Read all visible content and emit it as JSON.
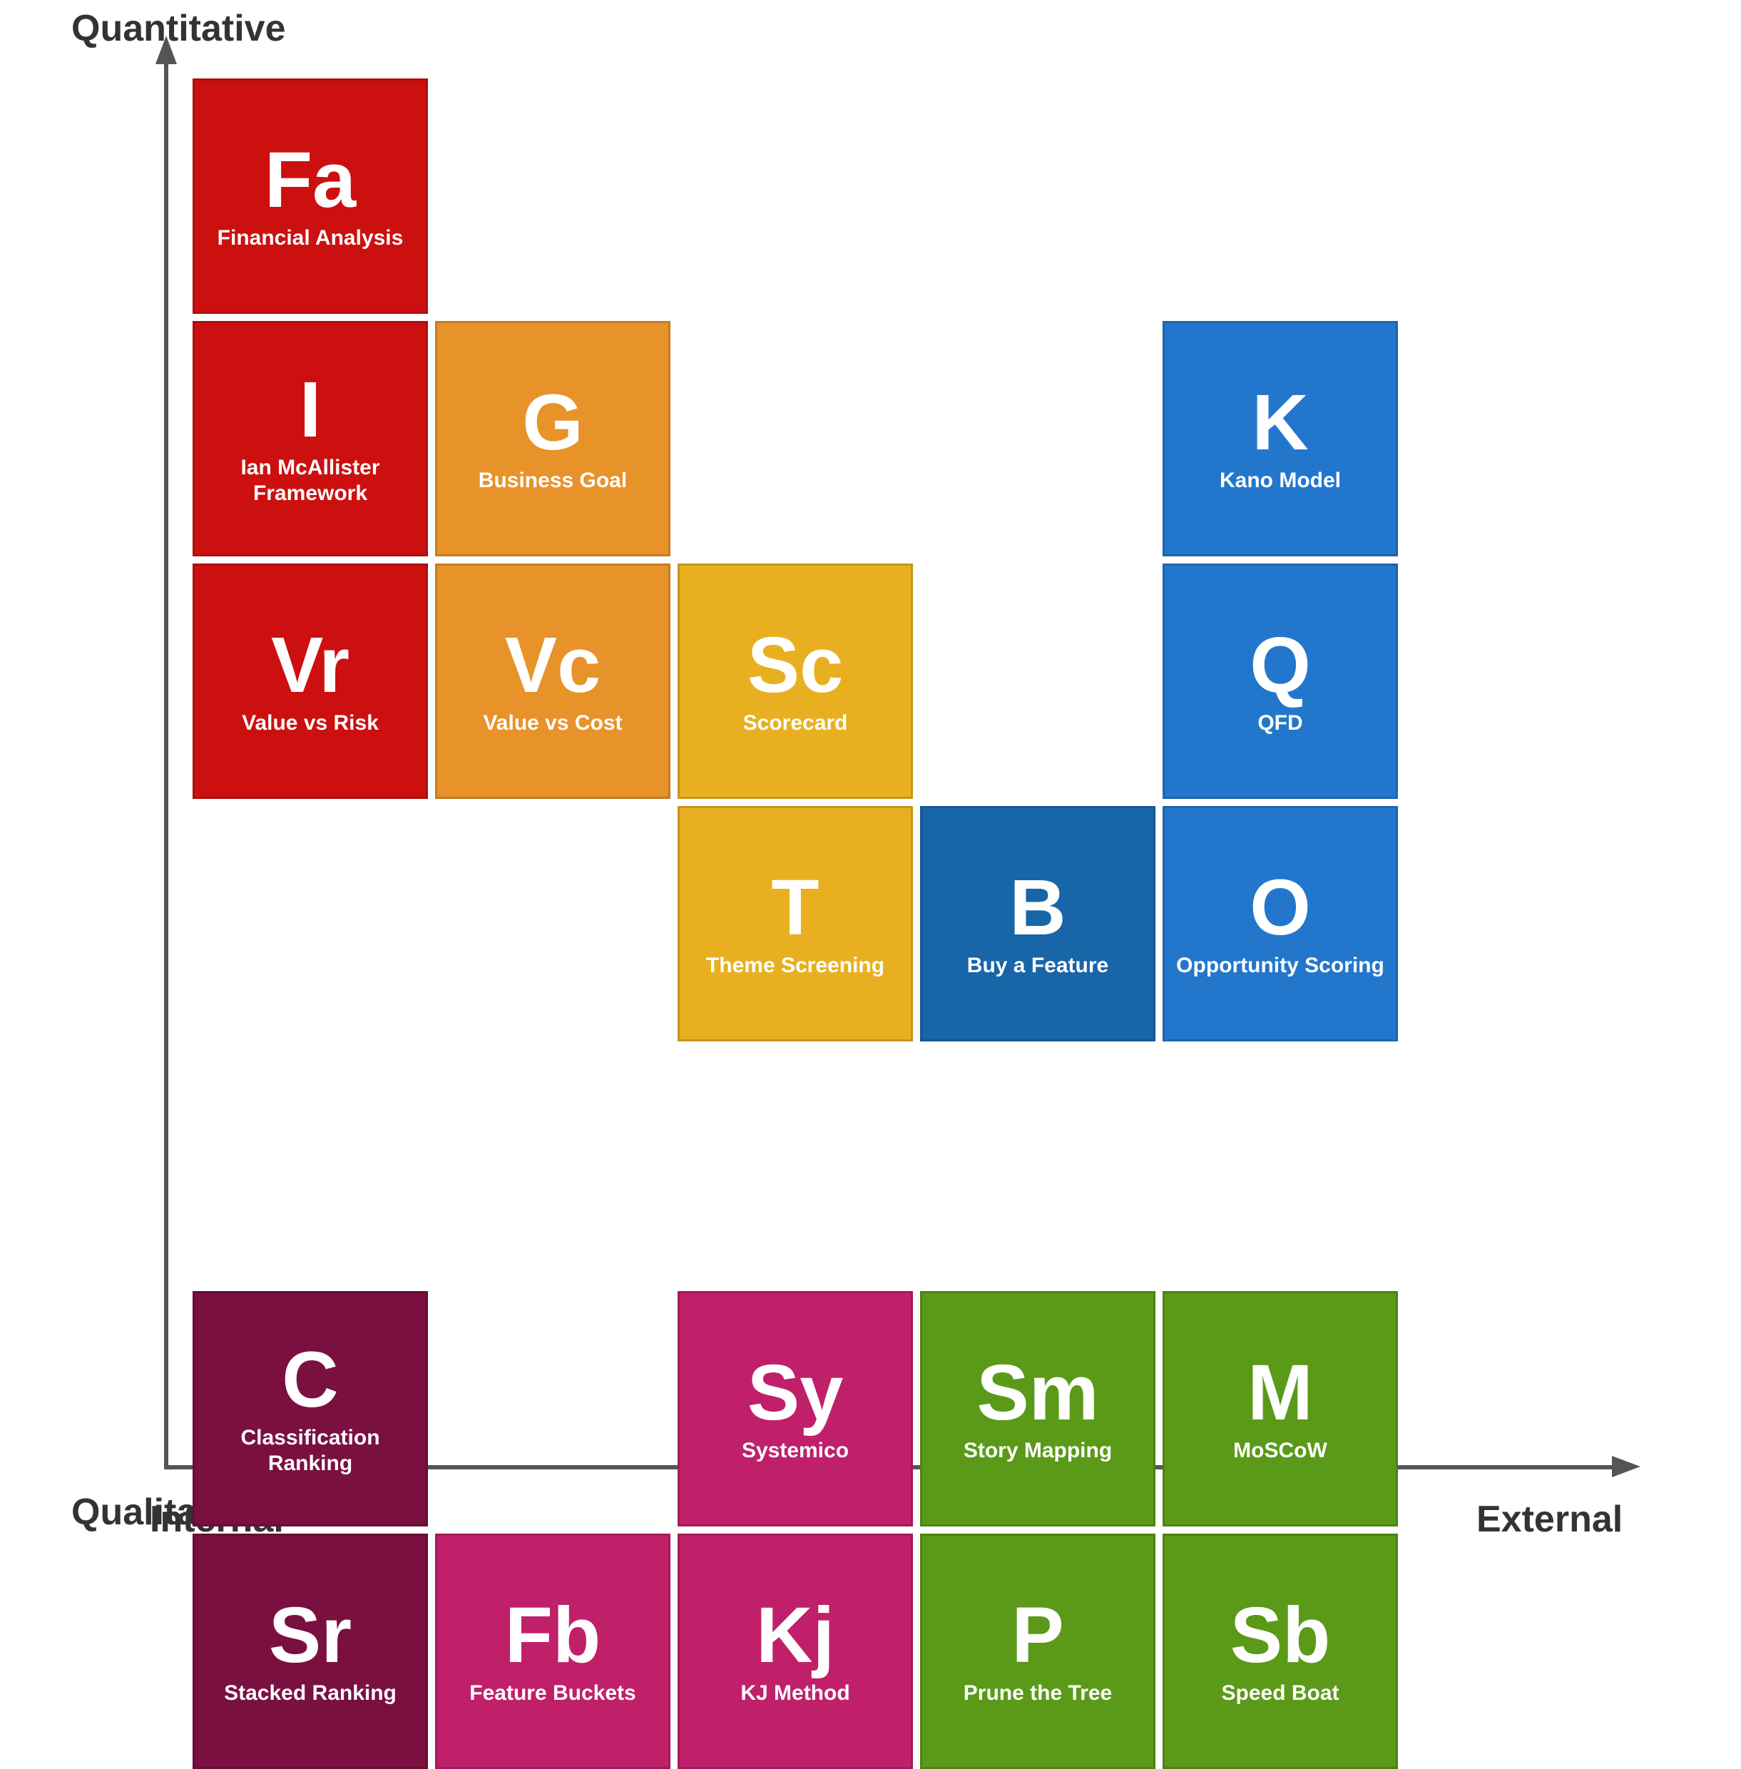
{
  "axes": {
    "y_top": "Quantitative",
    "y_bottom": "Qualitative",
    "x_left": "Internal",
    "x_right": "External"
  },
  "cards": [
    {
      "id": "fa",
      "abbr": "Fa",
      "name": "Financial Analysis",
      "color": "red",
      "col": 0,
      "row": 0
    },
    {
      "id": "i",
      "abbr": "I",
      "name": "Ian McAllister Framework",
      "color": "red",
      "col": 0,
      "row": 1
    },
    {
      "id": "g",
      "abbr": "G",
      "name": "Business Goal",
      "color": "orange",
      "col": 1,
      "row": 1
    },
    {
      "id": "vr",
      "abbr": "Vr",
      "name": "Value vs Risk",
      "color": "red",
      "col": 0,
      "row": 2
    },
    {
      "id": "vc",
      "abbr": "Vc",
      "name": "Value vs Cost",
      "color": "orange",
      "col": 1,
      "row": 2
    },
    {
      "id": "sc",
      "abbr": "Sc",
      "name": "Scorecard",
      "color": "gold",
      "col": 2,
      "row": 2
    },
    {
      "id": "t",
      "abbr": "T",
      "name": "Theme Screening",
      "color": "gold",
      "col": 2,
      "row": 3
    },
    {
      "id": "b",
      "abbr": "B",
      "name": "Buy a Feature",
      "color": "dark-blue",
      "col": 3,
      "row": 3
    },
    {
      "id": "o",
      "abbr": "O",
      "name": "Opportunity Scoring",
      "color": "blue",
      "col": 4,
      "row": 3
    },
    {
      "id": "k",
      "abbr": "K",
      "name": "Kano Model",
      "color": "blue",
      "col": 4,
      "row": 1
    },
    {
      "id": "q",
      "abbr": "Q",
      "name": "QFD",
      "color": "blue",
      "col": 4,
      "row": 2
    },
    {
      "id": "c",
      "abbr": "C",
      "name": "Classification Ranking",
      "color": "purple",
      "col": 0,
      "row": 5
    },
    {
      "id": "sy",
      "abbr": "Sy",
      "name": "Systemico",
      "color": "magenta",
      "col": 2,
      "row": 5
    },
    {
      "id": "sm",
      "abbr": "Sm",
      "name": "Story Mapping",
      "color": "green",
      "col": 3,
      "row": 5
    },
    {
      "id": "m",
      "abbr": "M",
      "name": "MoSCoW",
      "color": "green",
      "col": 4,
      "row": 5
    },
    {
      "id": "sr",
      "abbr": "Sr",
      "name": "Stacked Ranking",
      "color": "purple",
      "col": 0,
      "row": 6
    },
    {
      "id": "fb",
      "abbr": "Fb",
      "name": "Feature Buckets",
      "color": "magenta",
      "col": 1,
      "row": 6
    },
    {
      "id": "kj",
      "abbr": "Kj",
      "name": "KJ Method",
      "color": "magenta",
      "col": 2,
      "row": 6
    },
    {
      "id": "p",
      "abbr": "P",
      "name": "Prune the Tree",
      "color": "green",
      "col": 3,
      "row": 6
    },
    {
      "id": "sb",
      "abbr": "Sb",
      "name": "Speed Boat",
      "color": "green",
      "col": 4,
      "row": 6
    }
  ],
  "card_size": 330,
  "card_gap": 10
}
